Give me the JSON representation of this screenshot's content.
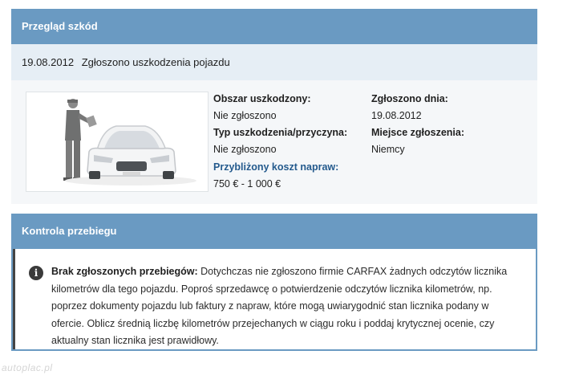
{
  "damage": {
    "header": "Przegląd szkód",
    "event_date": "19.08.2012",
    "event_text": "Zgłoszono uszkodzenia pojazdu",
    "area_label": "Obszar uszkodzony:",
    "area_value": "Nie zgłoszono",
    "type_label": "Typ uszkodzenia/przyczyna:",
    "type_value": "Nie zgłoszono",
    "cost_label": "Przybliżony koszt napraw:",
    "cost_value": "750 € - 1 000 €",
    "reported_label": "Zgłoszono dnia:",
    "reported_value": "19.08.2012",
    "place_label": "Miejsce zgłoszenia:",
    "place_value": "Niemcy",
    "illustration": "car-inspection-illustration"
  },
  "mileage": {
    "header": "Kontrola przebiegu",
    "icon": "info-icon",
    "bold": "Brak zgłoszonych przebiegów:",
    "text": " Dotychczas nie zgłoszono firmie CARFAX żadnych odczytów licznika kilometrów dla tego pojazdu. Poproś sprzedawcę o potwierdzenie odczytów licznika kilometrów, np. poprzez dokumenty pojazdu lub faktury z napraw, które mogą uwiarygodnić stan licznika podany w ofercie. Oblicz średnią liczbę kilometrów przejechanych w ciągu roku i poddaj krytycznej ocenie, czy aktualny stan licznika jest prawidłowy."
  },
  "watermark": "autoplac.pl",
  "colors": {
    "header": "#6a9ac2",
    "subheader": "#e6eef5",
    "link_blue": "#245a8d"
  }
}
